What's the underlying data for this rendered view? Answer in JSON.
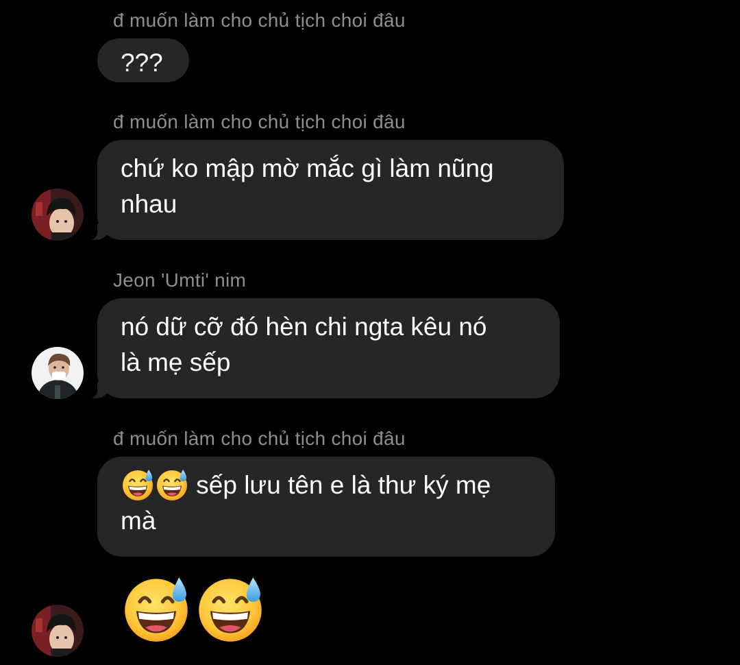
{
  "messages": [
    {
      "sender": "đ muốn làm cho chủ tịch choi đâu",
      "text": "???"
    },
    {
      "sender": "đ muốn làm cho chủ tịch choi đâu",
      "text_line1": "chứ ko mập mờ mắc gì làm nũng",
      "text_line2": "nhau",
      "avatar": "avatar-dark-hair-boy"
    },
    {
      "sender": "Jeon 'Umti' nim",
      "text_line1": "nó dữ cỡ đó hèn chi ngta kêu nó",
      "text_line2": "là mẹ sếp",
      "avatar": "avatar-boy-black-jacket"
    },
    {
      "sender": "đ muốn làm cho chủ tịch choi đâu",
      "emoji_prefix": [
        "grinning-face-with-sweat",
        "grinning-face-with-sweat"
      ],
      "text_line1": "sếp lưu tên e là thư ký mẹ",
      "text_line2": "mà"
    },
    {
      "big_emojis": [
        "grinning-face-with-sweat",
        "grinning-face-with-sweat"
      ],
      "avatar": "avatar-dark-hair-boy"
    }
  ],
  "colors": {
    "background": "#000000",
    "bubble": "#262628",
    "sender_name": "#8e8e93",
    "text": "#ffffff"
  }
}
